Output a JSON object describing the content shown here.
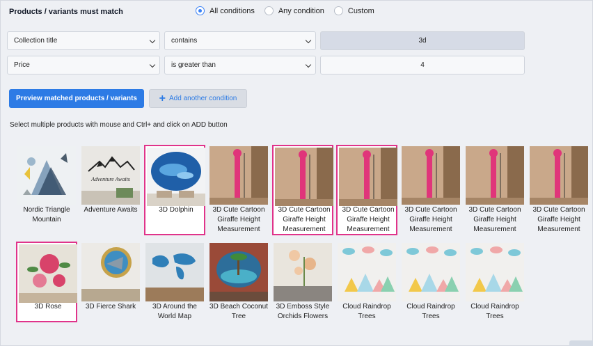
{
  "conditions_header": {
    "label": "Products / variants must match",
    "options": [
      "All conditions",
      "Any condition",
      "Custom"
    ],
    "selected": "All conditions"
  },
  "conditions": [
    {
      "field": "Collection title",
      "operator": "contains",
      "value": "3d"
    },
    {
      "field": "Price",
      "operator": "is greater than",
      "value": "4"
    }
  ],
  "buttons": {
    "preview": "Preview matched products / variants",
    "add_condition": "Add another condition",
    "add_icon": "plus-icon"
  },
  "hint": "Select multiple products with mouse and Ctrl+ and click on ADD button",
  "colors": {
    "accent": "#2d7be5",
    "selected_border": "#e0338a",
    "value_filled_bg": "#d6dbe6"
  },
  "products": [
    {
      "name": "Nordic Triangle Mountain",
      "selected": false
    },
    {
      "name": "Adventure Awaits",
      "selected": false
    },
    {
      "name": "3D Dolphin",
      "selected": true
    },
    {
      "name": "3D Cute Cartoon Giraffe Height Measurement",
      "selected": false
    },
    {
      "name": "3D Cute Cartoon Giraffe Height Measurement",
      "selected": true
    },
    {
      "name": "3D Cute Cartoon Giraffe Height Measurement",
      "selected": true
    },
    {
      "name": "3D Cute Cartoon Giraffe Height Measurement",
      "selected": false
    },
    {
      "name": "3D Cute Cartoon Giraffe Height Measurement",
      "selected": false
    },
    {
      "name": "3D Cute Cartoon Giraffe Height Measurement",
      "selected": false
    },
    {
      "name": "3D Rose",
      "selected": true
    },
    {
      "name": "3D Fierce Shark",
      "selected": false
    },
    {
      "name": "3D Around the World Map",
      "selected": false
    },
    {
      "name": "3D Beach Coconut Tree",
      "selected": false
    },
    {
      "name": "3D Emboss Style Orchids Flowers",
      "selected": false
    },
    {
      "name": "Cloud Raindrop Trees",
      "selected": false
    },
    {
      "name": "Cloud Raindrop Trees",
      "selected": false
    },
    {
      "name": "Cloud Raindrop Trees",
      "selected": false
    }
  ],
  "thumb_text": {
    "adventure": "Adventure Awaits"
  }
}
